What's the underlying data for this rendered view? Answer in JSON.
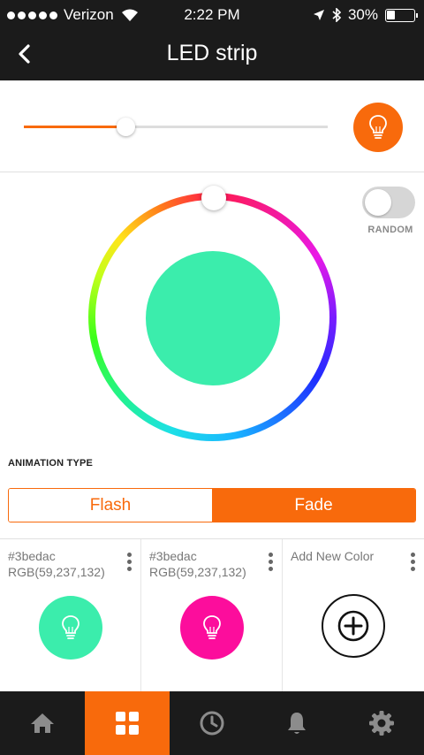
{
  "status_bar": {
    "carrier": "Verizon",
    "time": "2:22 PM",
    "battery_percent": "30%",
    "battery_level": 0.3,
    "signal_icon": "signal-dots-icon",
    "wifi_icon": "wifi-icon",
    "location_icon": "location-arrow-icon",
    "bluetooth_icon": "bluetooth-icon"
  },
  "header": {
    "title": "LED strip",
    "back_icon": "chevron-left-icon"
  },
  "brightness": {
    "level": 0.335,
    "accent": "#f86a0c",
    "bulb_icon": "lightbulb-icon"
  },
  "color_picker": {
    "selected_color": "#3bedac",
    "wheel_position_deg": 0
  },
  "random": {
    "label": "RANDOM",
    "enabled": false
  },
  "animation": {
    "label": "ANIMATION TYPE",
    "options": [
      "Flash",
      "Fade"
    ],
    "selected": "Fade"
  },
  "colors": [
    {
      "hex": "#3bedac",
      "rgb": "RGB(59,237,132)",
      "swatch": "#3bedac"
    },
    {
      "hex": "#3bedac",
      "rgb": "RGB(59,237,132)",
      "swatch": "#fc0d9c"
    }
  ],
  "add_color": {
    "label": "Add New Color",
    "icon": "plus-circle-icon"
  },
  "tabs": [
    {
      "icon": "home-icon",
      "active": false
    },
    {
      "icon": "grid-icon",
      "active": true
    },
    {
      "icon": "clock-icon",
      "active": false
    },
    {
      "icon": "bell-icon",
      "active": false
    },
    {
      "icon": "gear-icon",
      "active": false
    }
  ]
}
